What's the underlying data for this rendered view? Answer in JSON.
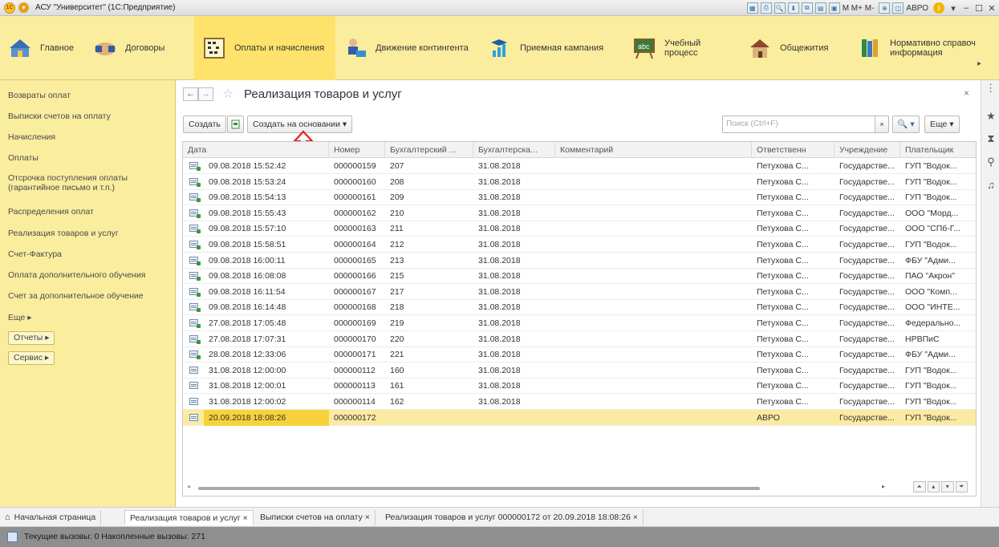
{
  "window": {
    "title": "АСУ \"Университет\" (1С:Предприятие)",
    "logo_text": "1С",
    "tools_text": "M  M+  M-",
    "user": "АВРО"
  },
  "sections": [
    {
      "label": "Главное",
      "icon": "home-section-icon"
    },
    {
      "label": "Договоры",
      "icon": "handshake-icon"
    },
    {
      "label": "Оплаты и начисления",
      "icon": "abacus-icon"
    },
    {
      "label": "Движение контингента",
      "icon": "person-desk-icon"
    },
    {
      "label": "Приемная кампания",
      "icon": "graduate-chart-icon"
    },
    {
      "label": "Учебный процесс",
      "icon": "abc-board-icon"
    },
    {
      "label": "Общежития",
      "icon": "house-icon"
    },
    {
      "label": "Нормативно справоч информация",
      "icon": "books-icon"
    }
  ],
  "sidebar": {
    "items": [
      "Возвраты оплат",
      "Выписки счетов на оплату",
      "Начисления",
      "Оплаты",
      "Отсрочка поступления оплаты (гарантийное письмо и т.п.)",
      "Распределения оплат",
      "Реализация товаров и услуг",
      "Счет-Фактура",
      "Оплата дополнительного обучения",
      "Счет за дополнительное обучение",
      "Еще ▸"
    ],
    "buttons": [
      "Отчеты ▸",
      "Сервис ▸"
    ]
  },
  "form": {
    "title": "Реализация товаров и услуг",
    "create_label": "Создать",
    "create_based_label": "Создать на основании ▾",
    "search_placeholder": "Поиск (Ctrl+F)",
    "more_label": "Еще ▾",
    "search_button": "🔍 ▾"
  },
  "table": {
    "columns": [
      "Дата",
      "Номер",
      "Бухгалтерский ...",
      "Бухгалтерска...",
      "Комментарий",
      "Ответственн",
      "Учреждение",
      "Плательщик"
    ],
    "rows": [
      {
        "posted": true,
        "date": "09.08.2018 15:52:42",
        "number": "000000159",
        "acc_num": "207",
        "acc_date": "31.08.2018",
        "comment": "",
        "resp": "Петухова С...",
        "org": "Государстве...",
        "payer": "ГУП \"Водок..."
      },
      {
        "posted": true,
        "date": "09.08.2018 15:53:24",
        "number": "000000160",
        "acc_num": "208",
        "acc_date": "31.08.2018",
        "comment": "",
        "resp": "Петухова С...",
        "org": "Государстве...",
        "payer": "ГУП \"Водок..."
      },
      {
        "posted": true,
        "date": "09.08.2018 15:54:13",
        "number": "000000161",
        "acc_num": "209",
        "acc_date": "31.08.2018",
        "comment": "",
        "resp": "Петухова С...",
        "org": "Государстве...",
        "payer": "ГУП \"Водок..."
      },
      {
        "posted": true,
        "date": "09.08.2018 15:55:43",
        "number": "000000162",
        "acc_num": "210",
        "acc_date": "31.08.2018",
        "comment": "",
        "resp": "Петухова С...",
        "org": "Государстве...",
        "payer": "ООО \"Морд..."
      },
      {
        "posted": true,
        "date": "09.08.2018 15:57:10",
        "number": "000000163",
        "acc_num": "211",
        "acc_date": "31.08.2018",
        "comment": "",
        "resp": "Петухова С...",
        "org": "Государстве...",
        "payer": "ООО \"СПб-Г..."
      },
      {
        "posted": true,
        "date": "09.08.2018 15:58:51",
        "number": "000000164",
        "acc_num": "212",
        "acc_date": "31.08.2018",
        "comment": "",
        "resp": "Петухова С...",
        "org": "Государстве...",
        "payer": "ГУП \"Водок..."
      },
      {
        "posted": true,
        "date": "09.08.2018 16:00:11",
        "number": "000000165",
        "acc_num": "213",
        "acc_date": "31.08.2018",
        "comment": "",
        "resp": "Петухова С...",
        "org": "Государстве...",
        "payer": "ФБУ \"Адми..."
      },
      {
        "posted": true,
        "date": "09.08.2018 16:08:08",
        "number": "000000166",
        "acc_num": "215",
        "acc_date": "31.08.2018",
        "comment": "",
        "resp": "Петухова С...",
        "org": "Государстве...",
        "payer": "ПАО \"Акрон\""
      },
      {
        "posted": true,
        "date": "09.08.2018 16:11:54",
        "number": "000000167",
        "acc_num": "217",
        "acc_date": "31.08.2018",
        "comment": "",
        "resp": "Петухова С...",
        "org": "Государстве...",
        "payer": "ООО \"Комп..."
      },
      {
        "posted": true,
        "date": "09.08.2018 16:14:48",
        "number": "000000168",
        "acc_num": "218",
        "acc_date": "31.08.2018",
        "comment": "",
        "resp": "Петухова С...",
        "org": "Государстве...",
        "payer": "ООО \"ИНТЕ..."
      },
      {
        "posted": true,
        "date": "27.08.2018 17:05:48",
        "number": "000000169",
        "acc_num": "219",
        "acc_date": "31.08.2018",
        "comment": "",
        "resp": "Петухова С...",
        "org": "Государстве...",
        "payer": "Федерально..."
      },
      {
        "posted": true,
        "date": "27.08.2018 17:07:31",
        "number": "000000170",
        "acc_num": "220",
        "acc_date": "31.08.2018",
        "comment": "",
        "resp": "Петухова С...",
        "org": "Государстве...",
        "payer": "НРВПиС"
      },
      {
        "posted": true,
        "date": "28.08.2018 12:33:06",
        "number": "000000171",
        "acc_num": "221",
        "acc_date": "31.08.2018",
        "comment": "",
        "resp": "Петухова С...",
        "org": "Государстве...",
        "payer": "ФБУ \"Адми..."
      },
      {
        "posted": false,
        "date": "31.08.2018 12:00:00",
        "number": "000000112",
        "acc_num": "160",
        "acc_date": "31.08.2018",
        "comment": "",
        "resp": "Петухова С...",
        "org": "Государстве...",
        "payer": "ГУП \"Водок..."
      },
      {
        "posted": false,
        "date": "31.08.2018 12:00:01",
        "number": "000000113",
        "acc_num": "161",
        "acc_date": "31.08.2018",
        "comment": "",
        "resp": "Петухова С...",
        "org": "Государстве...",
        "payer": "ГУП \"Водок..."
      },
      {
        "posted": false,
        "date": "31.08.2018 12:00:02",
        "number": "000000114",
        "acc_num": "162",
        "acc_date": "31.08.2018",
        "comment": "",
        "resp": "Петухова С...",
        "org": "Государстве...",
        "payer": "ГУП \"Водок..."
      },
      {
        "posted": false,
        "selected": true,
        "date": "20.09.2018 18:08:26",
        "number": "000000172",
        "acc_num": "",
        "acc_date": "",
        "comment": "",
        "resp": "АВРО",
        "org": "Государстве...",
        "payer": "ГУП \"Водок..."
      }
    ]
  },
  "tabs": [
    {
      "label": "Начальная страница",
      "home": true
    },
    {
      "label": "Реализация товаров и услуг ×",
      "active": true
    },
    {
      "label": "Выписки счетов на оплату ×"
    },
    {
      "label": "Реализация товаров и услуг 000000172 от 20.09.2018 18:08:26 ×"
    }
  ],
  "status": {
    "text": "Текущие вызовы: 0   Накопленные вызовы: 271"
  },
  "colors": {
    "section_bg": "#fbed9e",
    "section_active": "#fde36b",
    "selected_row": "#fbeaa1",
    "selected_cell": "#f7d23a",
    "annotation_red": "#e02020"
  }
}
